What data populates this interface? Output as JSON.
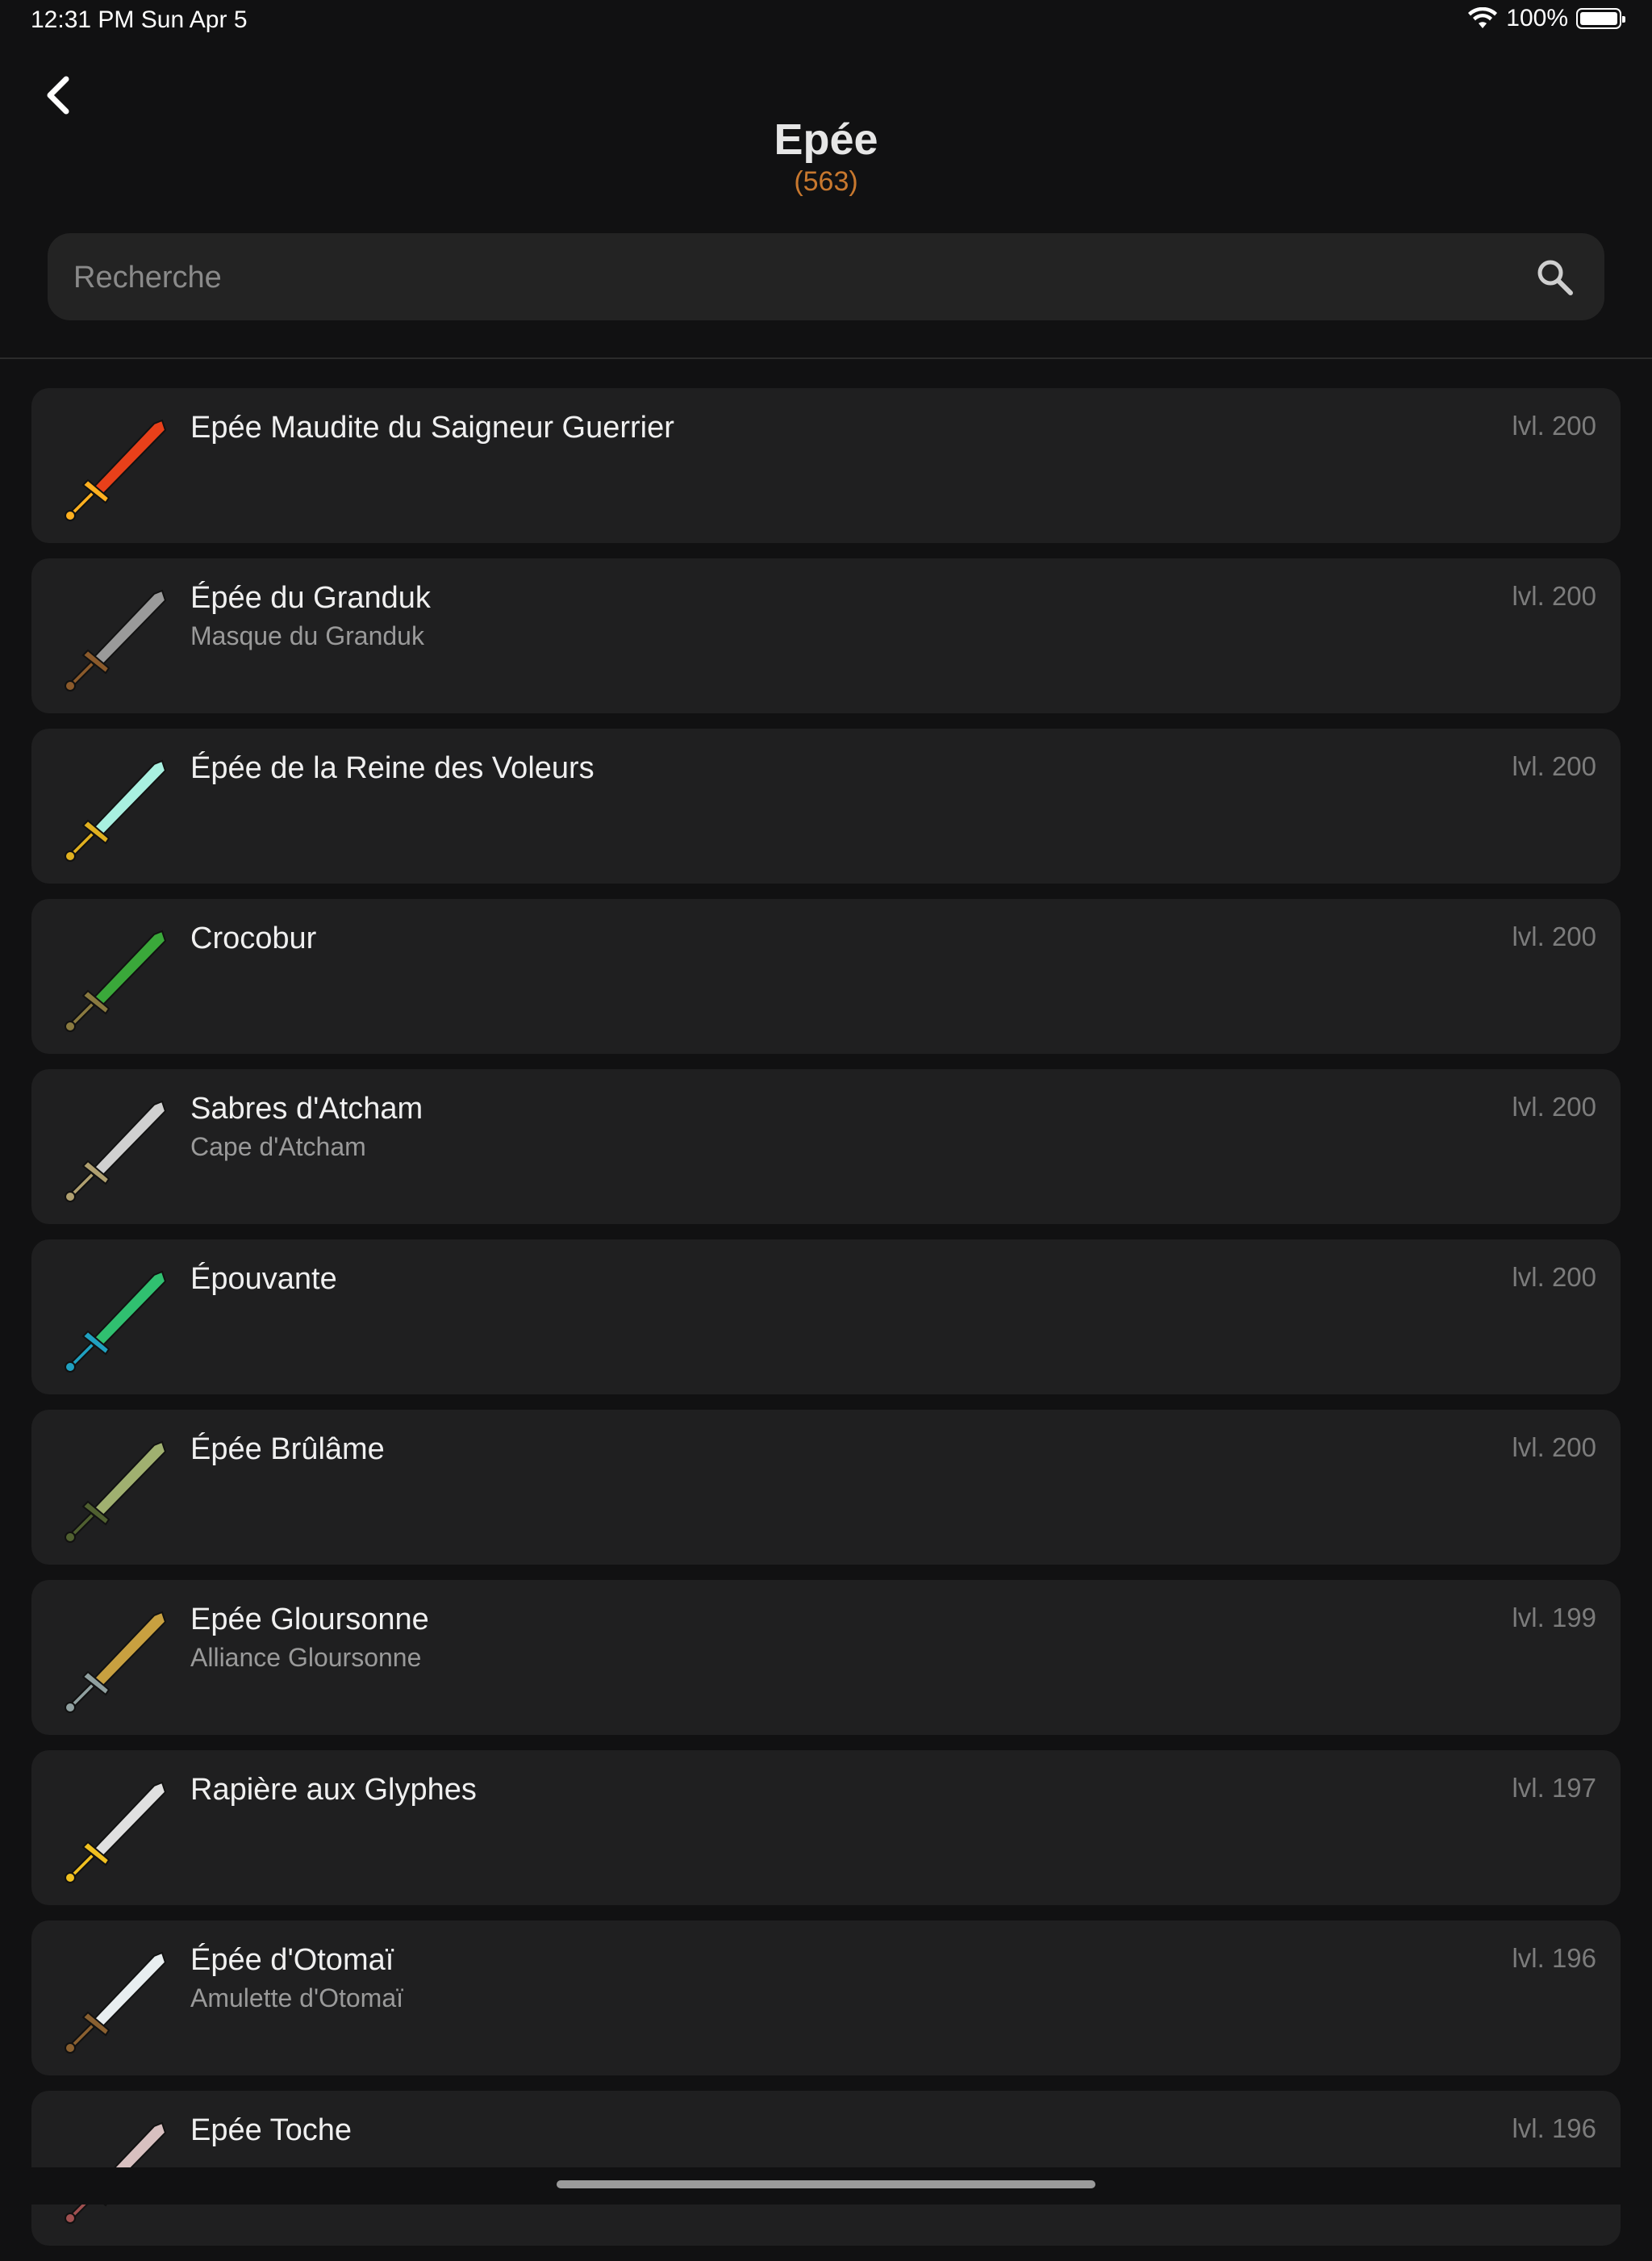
{
  "status_bar": {
    "time": "12:31 PM   Sun Apr 5",
    "battery": "100%"
  },
  "header": {
    "title": "Epée",
    "count": "(563)"
  },
  "search": {
    "placeholder": "Recherche"
  },
  "items": [
    {
      "name": "Epée Maudite du Saigneur Guerrier",
      "set": "",
      "level": "lvl. 200",
      "icon": "cursed-red-blade-icon",
      "colors": [
        "#e8401a",
        "#ffb020"
      ]
    },
    {
      "name": "Épée du Granduk",
      "set": "Masque du Granduk",
      "level": "lvl. 200",
      "icon": "granduk-sword-icon",
      "colors": [
        "#9a9a9a",
        "#8b5a2b"
      ]
    },
    {
      "name": "Épée de la Reine des Voleurs",
      "set": "",
      "level": "lvl. 200",
      "icon": "thief-queen-sword-icon",
      "colors": [
        "#a8f0e0",
        "#e0b020"
      ]
    },
    {
      "name": "Crocobur",
      "set": "",
      "level": "lvl. 200",
      "icon": "crocobur-sword-icon",
      "colors": [
        "#3aa83a",
        "#8a7a40"
      ]
    },
    {
      "name": "Sabres d'Atcham",
      "set": "Cape d'Atcham",
      "level": "lvl. 200",
      "icon": "atcham-sabres-icon",
      "colors": [
        "#d0d0d0",
        "#b0a070"
      ]
    },
    {
      "name": "Épouvante",
      "set": "",
      "level": "lvl. 200",
      "icon": "epouvante-sword-icon",
      "colors": [
        "#30c070",
        "#20a0c0"
      ]
    },
    {
      "name": "Épée Brûlâme",
      "set": "",
      "level": "lvl. 200",
      "icon": "brulame-sword-icon",
      "colors": [
        "#a0b070",
        "#506030"
      ]
    },
    {
      "name": "Epée Gloursonne",
      "set": "Alliance Gloursonne",
      "level": "lvl. 199",
      "icon": "gloursonne-sword-icon",
      "colors": [
        "#c8a040",
        "#90a0a0"
      ]
    },
    {
      "name": "Rapière aux Glyphes",
      "set": "",
      "level": "lvl. 197",
      "icon": "glyph-rapier-icon",
      "colors": [
        "#e0e0e0",
        "#f0c020"
      ]
    },
    {
      "name": "Épée d'Otomaï",
      "set": "Amulette d'Otomaï",
      "level": "lvl. 196",
      "icon": "otomai-sword-icon",
      "colors": [
        "#e8eef0",
        "#8a6030"
      ]
    },
    {
      "name": "Epée Toche",
      "set": "",
      "level": "lvl. 196",
      "icon": "toche-sword-icon",
      "colors": [
        "#d8c0c0",
        "#a05050"
      ]
    }
  ]
}
